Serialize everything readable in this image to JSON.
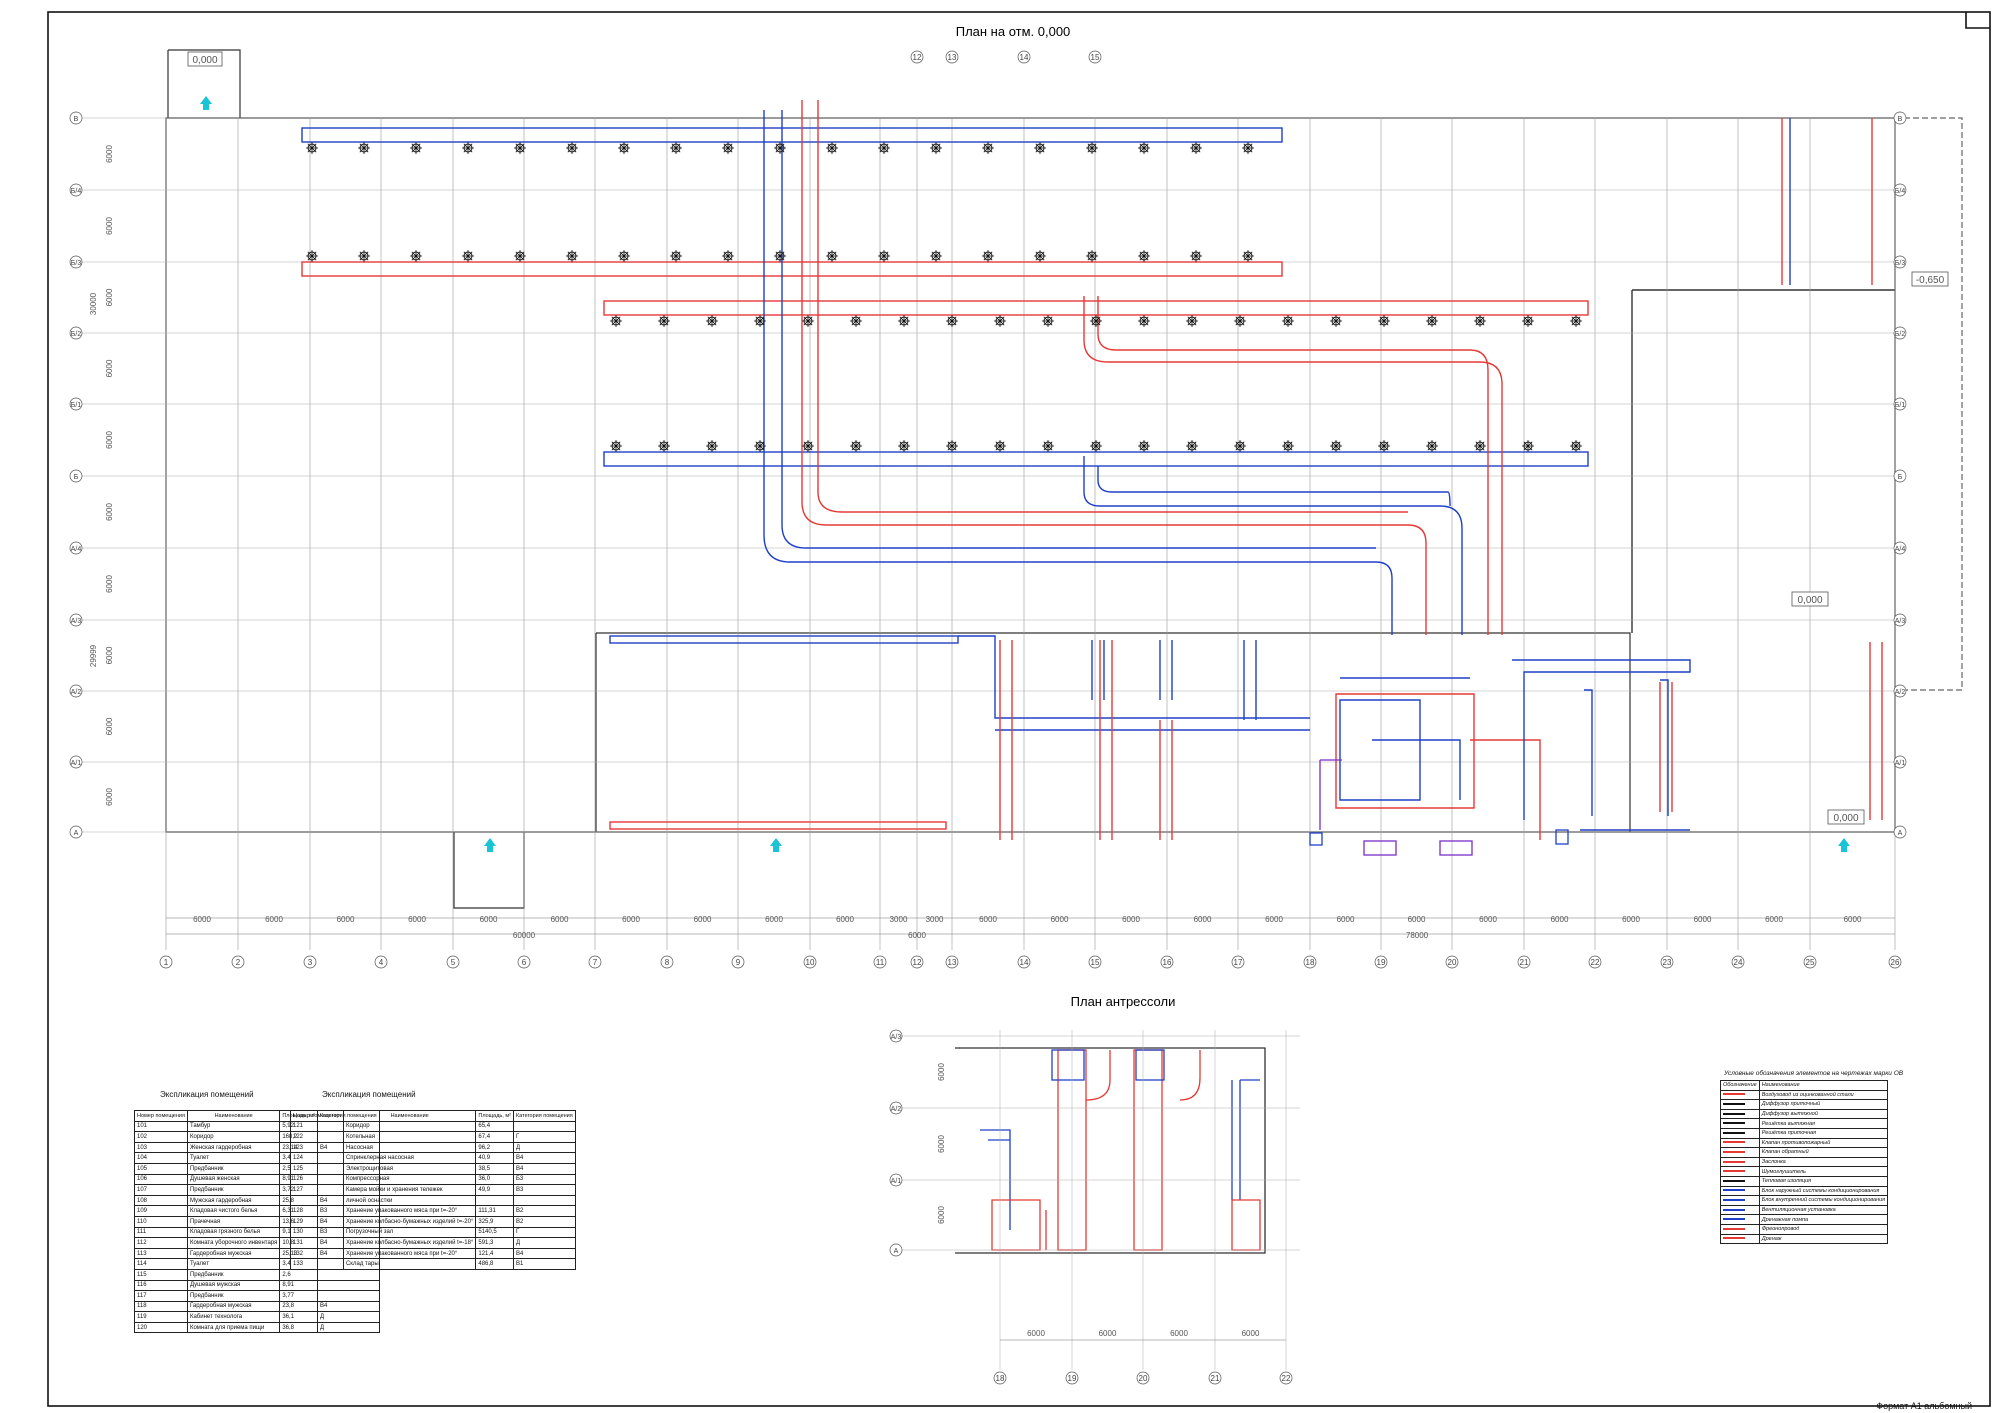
{
  "sheet": {
    "title_main": "План на отм. 0,000",
    "title_mezz": "План антрессоли",
    "format": "Формат А1 альбомный",
    "level_top_left": "0,000",
    "level_right": "-0,650",
    "level_mid": "0,000",
    "level_bottom_right": "0,000"
  },
  "axes": {
    "columns": [
      "1",
      "2",
      "3",
      "4",
      "5",
      "6",
      "7",
      "8",
      "9",
      "10",
      "11",
      "12",
      "13",
      "14",
      "15",
      "16",
      "17",
      "18",
      "19",
      "20",
      "21",
      "22",
      "23",
      "24",
      "25",
      "26"
    ],
    "top_columns": [
      "12",
      "13",
      "14",
      "15"
    ],
    "rows": [
      "В",
      "Б/4",
      "Б/3",
      "Б/2",
      "Б/1",
      "Б",
      "А/4",
      "А/3",
      "А/2",
      "А/1",
      "А"
    ],
    "row_dims": [
      "6000",
      "6000",
      "6000",
      "6000",
      "6000",
      "6000",
      "6000",
      "6000",
      "6000",
      "6000"
    ],
    "row_total_upper": "30000",
    "row_total_lower": "29999",
    "col_dims": [
      "6000",
      "6000",
      "6000",
      "6000",
      "6000",
      "6000",
      "6000",
      "6000",
      "6000",
      "6000",
      "3000",
      "3000",
      "6000",
      "6000",
      "6000",
      "6000",
      "6000",
      "6000",
      "6000",
      "6000",
      "6000",
      "6000",
      "6000",
      "6000",
      "6000"
    ],
    "col_total_left": "60000",
    "col_total_right": "78000",
    "col_mid": "6000"
  },
  "mezzanine": {
    "rows": [
      "А/3",
      "А/2",
      "А/1",
      "А"
    ],
    "row_dims": [
      "6000",
      "6000",
      "6000"
    ],
    "columns": [
      "18",
      "19",
      "20",
      "21",
      "22"
    ],
    "col_dims": [
      "6000",
      "6000",
      "6000",
      "6000"
    ]
  },
  "explication_left": {
    "caption": "Экспликация помещений",
    "headers": [
      "Номер помещения",
      "Наименование",
      "Площадь, м²",
      "Категория помещения"
    ],
    "rows": [
      [
        "101",
        "Тамбур",
        "5,92",
        ""
      ],
      [
        "102",
        "Коридор",
        "168,2",
        ""
      ],
      [
        "103",
        "Женская гардеробная",
        "23,14",
        "В4"
      ],
      [
        "104",
        "Туалет",
        "3,4",
        ""
      ],
      [
        "105",
        "Предбанник",
        "2,5",
        ""
      ],
      [
        "106",
        "Душевая женская",
        "8,91",
        ""
      ],
      [
        "107",
        "Предбанник",
        "3,72",
        ""
      ],
      [
        "108",
        "Мужская гардеробная",
        "25,8",
        "В4"
      ],
      [
        "109",
        "Кладовая чистого белья",
        "6,31",
        "В3"
      ],
      [
        "110",
        "Прачечная",
        "13,6",
        "В4"
      ],
      [
        "111",
        "Кладовая грязного белья",
        "9,1",
        "В3"
      ],
      [
        "112",
        "Комната уборочного инвентаря",
        "10,8",
        "В4"
      ],
      [
        "113",
        "Гардеробная мужская",
        "25,13",
        "В4"
      ],
      [
        "114",
        "Туалет",
        "3,4",
        ""
      ],
      [
        "115",
        "Предбанник",
        "2,6",
        ""
      ],
      [
        "116",
        "Душевая мужская",
        "8,91",
        ""
      ],
      [
        "117",
        "Предбанник",
        "3,77",
        ""
      ],
      [
        "118",
        "Гардеробная мужская",
        "23,8",
        "В4"
      ],
      [
        "119",
        "Кабинет технолога",
        "36,1",
        "Д"
      ],
      [
        "120",
        "Комната для приема пищи",
        "36,8",
        "Д"
      ]
    ]
  },
  "explication_right": {
    "caption": "Экспликация помещений",
    "headers": [
      "Номер помещения",
      "Наименование",
      "Площадь, м²",
      "Категория помещения"
    ],
    "rows": [
      [
        "121",
        "Коридор",
        "65,4",
        ""
      ],
      [
        "122",
        "Котельная",
        "67,4",
        "Г"
      ],
      [
        "123",
        "Насосная",
        "96,2",
        "Д"
      ],
      [
        "124",
        "Спринклерная насосная",
        "40,9",
        "В4"
      ],
      [
        "125",
        "Электрощитовая",
        "38,5",
        "В4"
      ],
      [
        "126",
        "Компрессорная",
        "36,0",
        "Б3"
      ],
      [
        "127",
        "Камера мойки и хранения тележек",
        "49,9",
        "В3"
      ],
      [
        "",
        "личной оснастки",
        "",
        ""
      ],
      [
        "128",
        "Хранение упакованного мяса при t=-20°",
        "111,31",
        "В2"
      ],
      [
        "129",
        "Хранение колбасно-бумажных изделий t=-20°",
        "325,9",
        "В2"
      ],
      [
        "130",
        "Погрузочный зал",
        "5140,5",
        "Г"
      ],
      [
        "131",
        "Хранение колбасно-бумажных изделий t=-18°",
        "591,3",
        "Д"
      ],
      [
        "132",
        "Хранение упакованного мяса при t=-20°",
        "121,4",
        "В4"
      ],
      [
        "133",
        "Склад тары",
        "486,8",
        "В1"
      ]
    ]
  },
  "legend": {
    "title": "Условные обозначения элементов на чертежах марки ОВ",
    "headers": [
      "Обозначение",
      "Наименование"
    ],
    "items": [
      {
        "name": "Воздуховод из оцинкованной стали",
        "color": "#e53935"
      },
      {
        "name": "Диффузор приточный",
        "color": "#111111"
      },
      {
        "name": "Диффузор вытяжной",
        "color": "#111111"
      },
      {
        "name": "Решётка вытяжная",
        "color": "#111111"
      },
      {
        "name": "Решётка приточная",
        "color": "#111111"
      },
      {
        "name": "Клапан противопожарный",
        "color": "#e53935"
      },
      {
        "name": "Клапан обратный",
        "color": "#e53935"
      },
      {
        "name": "Заслонка",
        "color": "#e53935"
      },
      {
        "name": "Шумоглушитель",
        "color": "#e53935"
      },
      {
        "name": "Тепловая изоляция",
        "color": "#111111"
      },
      {
        "name": "Блок наружный системы кондиционирования",
        "color": "#1e40c8"
      },
      {
        "name": "Блок внутренний системы кондиционирования",
        "color": "#1e40c8"
      },
      {
        "name": "Вентиляционная установка",
        "color": "#1e40c8"
      },
      {
        "name": "Дренажная помпа",
        "color": "#1e40c8"
      },
      {
        "name": "Фреонопровод",
        "color": "#e53935"
      },
      {
        "name": "Дренаж",
        "color": "#e53935"
      }
    ]
  },
  "colors": {
    "supply": "#e53935",
    "exhaust": "#1e40c8",
    "linework": "#222222",
    "grid": "#555555",
    "accent_arrow": "#19c4d6",
    "unit_purple": "#7b2cc9"
  }
}
